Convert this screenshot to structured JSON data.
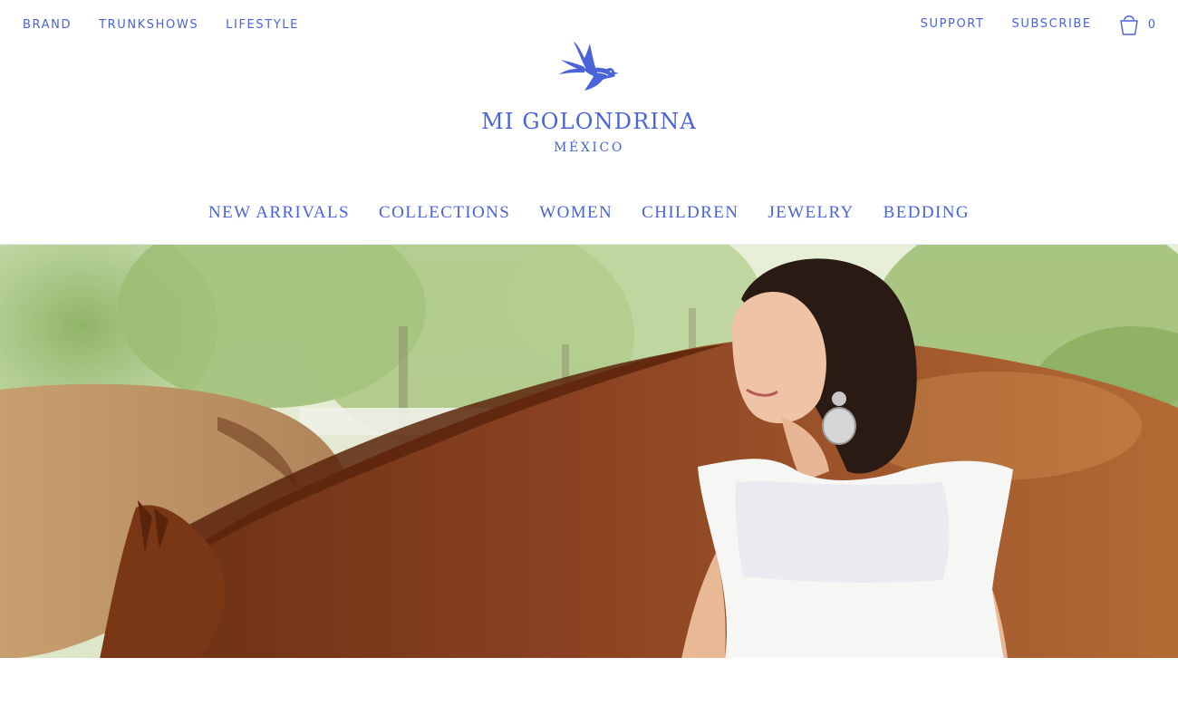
{
  "util_nav_left": [
    "BRAND",
    "TRUNKSHOWS",
    "LIFESTYLE"
  ],
  "util_nav_right": [
    "SUPPORT",
    "SUBSCRIBE"
  ],
  "cart": {
    "icon": "shopping-bag-icon",
    "count": "0"
  },
  "logo": {
    "name": "MI GOLONDRINA",
    "sub": "MÉXICO",
    "icon": "swallow-bird-icon"
  },
  "main_nav": [
    "NEW ARRIVALS",
    "COLLECTIONS",
    "WOMEN",
    "CHILDREN",
    "JEWELRY",
    "BEDDING"
  ],
  "hero": {
    "image": "woman-with-horses-photo"
  },
  "colors": {
    "brand": "#4a63d8",
    "background": "#ffffff"
  }
}
